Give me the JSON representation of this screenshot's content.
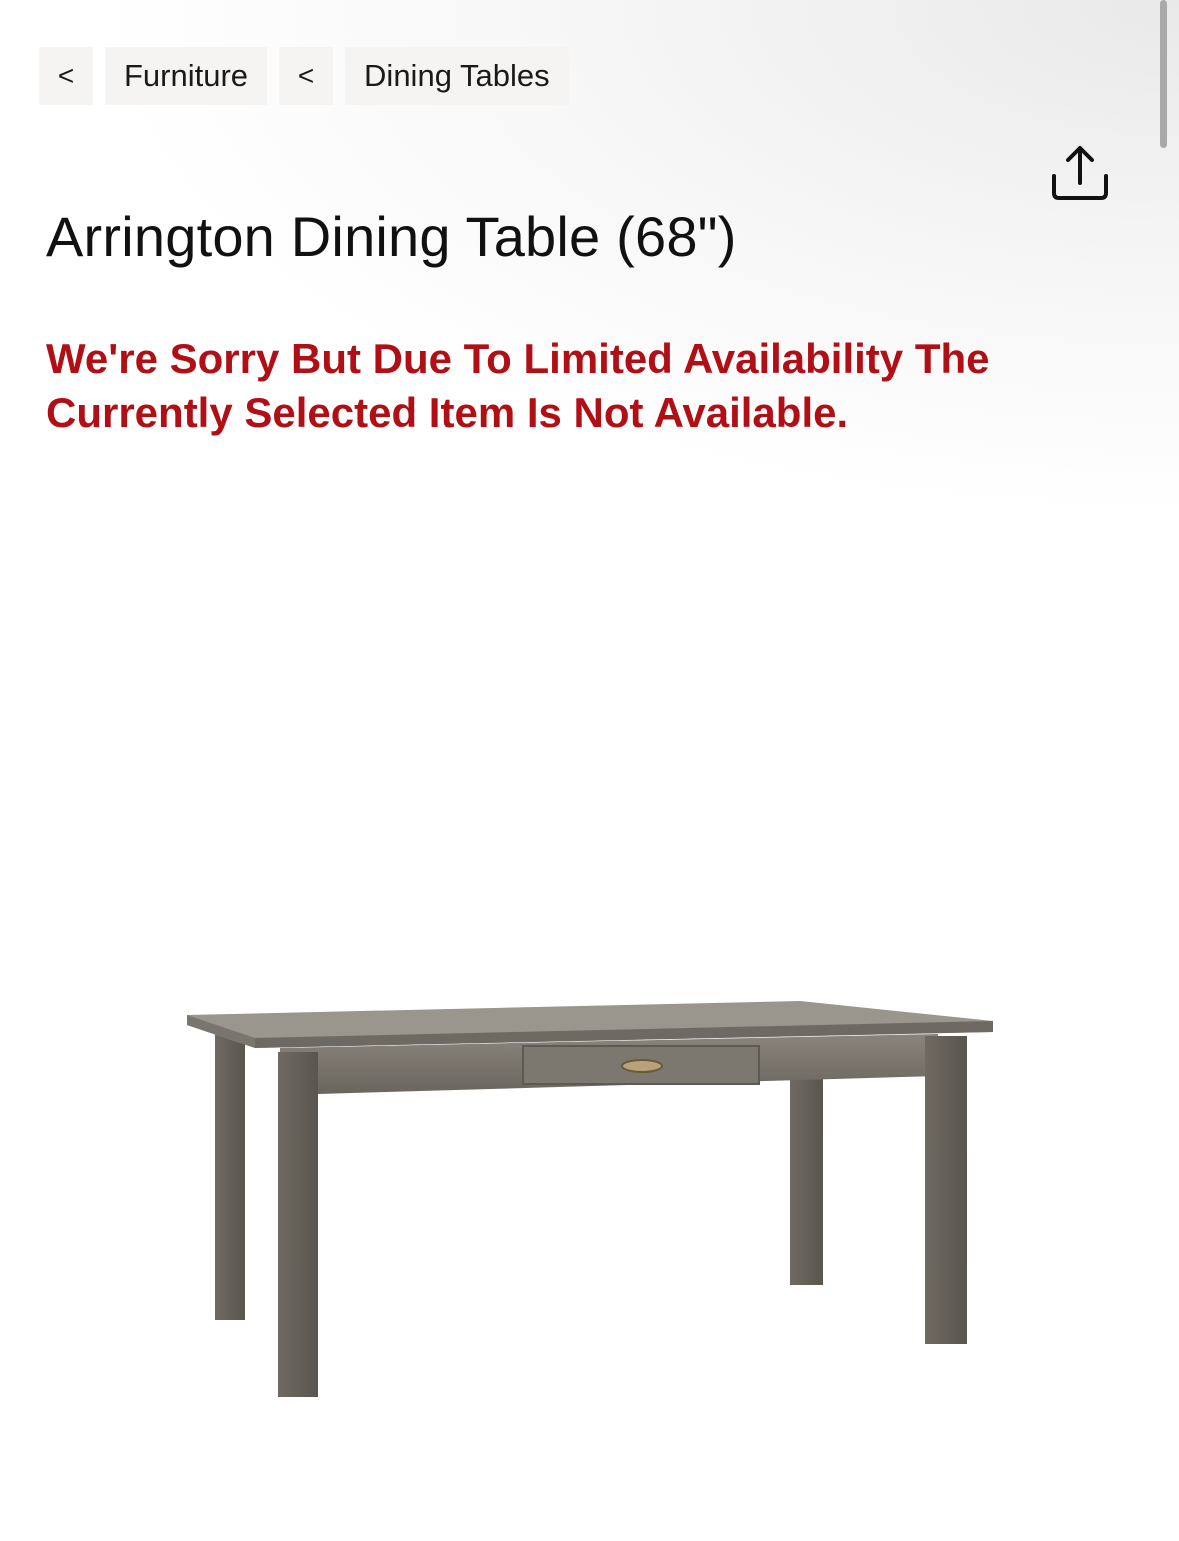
{
  "breadcrumb": {
    "items": [
      {
        "back": "<",
        "label": "Furniture"
      },
      {
        "back": "<",
        "label": "Dining Tables"
      }
    ]
  },
  "header": {
    "share_icon": "share-icon"
  },
  "product": {
    "title": "Arrington Dining Table (68\")",
    "availability_notice": "We're Sorry But Due To Limited Availability The Currently Selected Item Is Not Available.",
    "image_icon": "dining-table-image"
  },
  "colors": {
    "notice": "#b00f16",
    "title": "#111111",
    "crumb_bg": "#f5f4f2"
  }
}
